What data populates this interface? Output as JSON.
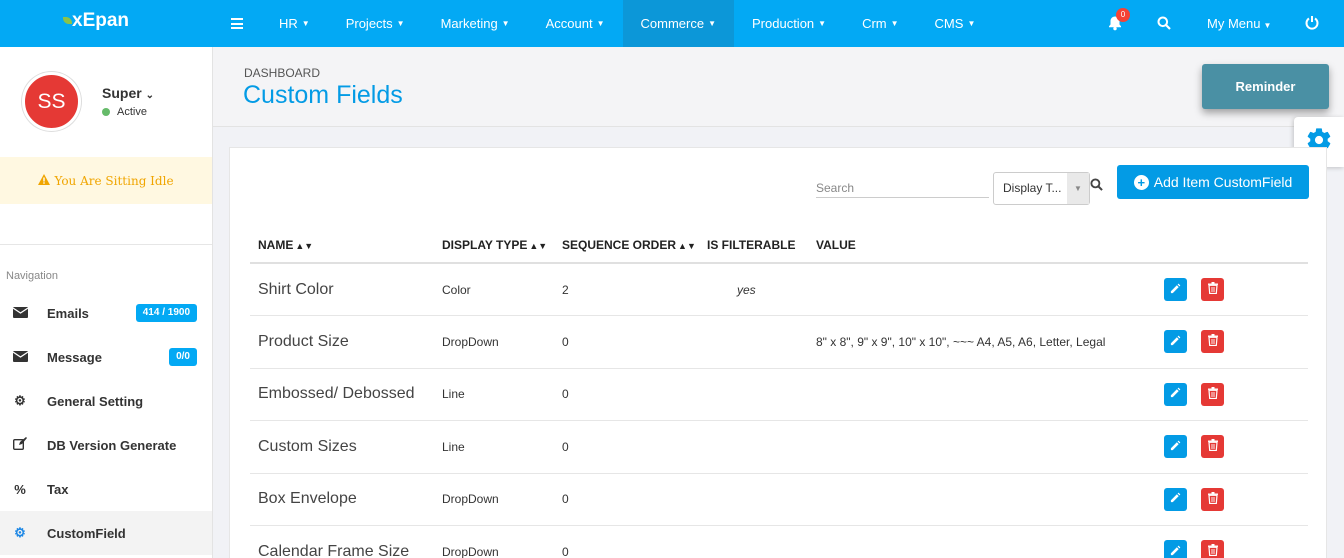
{
  "app": {
    "logo": "xEpan"
  },
  "topnav": {
    "items": [
      {
        "label": "HR",
        "left": 0
      },
      {
        "label": "Projects"
      },
      {
        "label": "Marketing"
      },
      {
        "label": "Account"
      },
      {
        "label": "Commerce"
      },
      {
        "label": "Production"
      },
      {
        "label": "Crm"
      },
      {
        "label": "CMS"
      }
    ],
    "active_item": "Commerce",
    "notifications_count": "0",
    "my_menu_label": "My Menu"
  },
  "user": {
    "initials": "SS",
    "name": "Super",
    "status": "Active",
    "idle_message": "You Are Sitting Idle"
  },
  "sidebar": {
    "title": "Navigation",
    "items": [
      {
        "label": "Emails",
        "icon": "envelope-icon",
        "badge": "414 / 1900"
      },
      {
        "label": "Message",
        "icon": "envelope-icon",
        "badge": "0/0"
      },
      {
        "label": "General Setting",
        "icon": "gear-icon"
      },
      {
        "label": "DB Version Generate",
        "icon": "edit-icon"
      },
      {
        "label": "Tax",
        "icon": "percent-icon"
      },
      {
        "label": "CustomField",
        "icon": "gear-icon",
        "active": true
      }
    ]
  },
  "header": {
    "breadcrumb": "DASHBOARD",
    "title": "Custom Fields",
    "reminder_label": "Reminder"
  },
  "toolbar": {
    "search_placeholder": "Search",
    "display_type_value": "Display T...",
    "add_label": "Add Item CustomField"
  },
  "table": {
    "columns": [
      "NAME",
      "DISPLAY TYPE",
      "SEQUENCE ORDER",
      "IS FILTERABLE",
      "VALUE"
    ],
    "rows": [
      {
        "name": "Shirt Color",
        "display_type": "Color",
        "sequence_order": "2",
        "is_filterable": "yes",
        "value": ""
      },
      {
        "name": "Product Size",
        "display_type": "DropDown",
        "sequence_order": "0",
        "is_filterable": "",
        "value": "8\" x 8\", 9\" x 9\", 10\" x 10\", ~~~ A4, A5, A6, Letter, Legal"
      },
      {
        "name": "Embossed/ Debossed",
        "display_type": "Line",
        "sequence_order": "0",
        "is_filterable": "",
        "value": ""
      },
      {
        "name": "Custom Sizes",
        "display_type": "Line",
        "sequence_order": "0",
        "is_filterable": "",
        "value": ""
      },
      {
        "name": "Box Envelope",
        "display_type": "DropDown",
        "sequence_order": "0",
        "is_filterable": "",
        "value": ""
      },
      {
        "name": "Calendar Frame Size",
        "display_type": "DropDown",
        "sequence_order": "0",
        "is_filterable": "",
        "value": ""
      }
    ]
  },
  "colors": {
    "primary": "#03a9f4",
    "danger": "#e53935",
    "idle_bg": "#fff8e1",
    "idle_text": "#f0a500",
    "reminder": "#4a90a4"
  }
}
